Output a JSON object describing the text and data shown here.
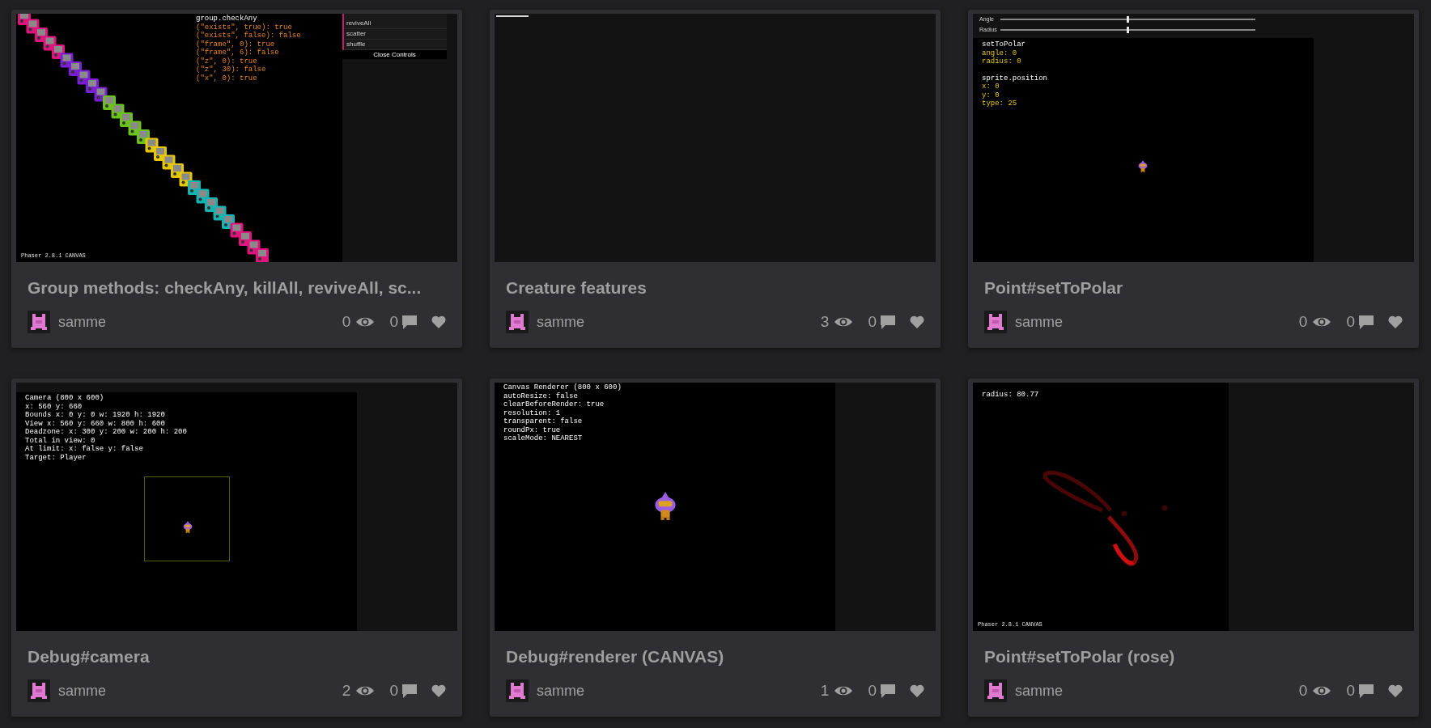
{
  "cards": [
    {
      "title": "Group methods: checkAny, killAll, reviveAll, sc...",
      "thumbnail": {
        "kind": "checkany",
        "blocks": [
          [
            {
              "text": "group.checkAny",
              "kind": "heading"
            },
            {
              "text": "(\"exists\", true): true",
              "kind": "result"
            },
            {
              "text": "(\"exists\", false): false",
              "kind": "result"
            },
            {
              "text": "(\"frame\", 0): true",
              "kind": "result"
            },
            {
              "text": "(\"frame\", 6): false",
              "kind": "result"
            },
            {
              "text": "(\"z\", 0): true",
              "kind": "result"
            },
            {
              "text": "(\"z\", 30): false",
              "kind": "result"
            },
            {
              "text": "(\"x\", 0): true",
              "kind": "result"
            }
          ]
        ],
        "menu": [
          "reviveAll",
          "scatter",
          "shuffle"
        ],
        "menu_button": "Close Controls",
        "footer": "Phaser 2.8.1 CANVAS"
      },
      "author": "samme",
      "views": "0",
      "comments": "0"
    },
    {
      "title": "Creature features",
      "thumbnail": {
        "kind": "blank"
      },
      "author": "samme",
      "views": "3",
      "comments": "0"
    },
    {
      "title": "Point#setToPolar",
      "thumbnail": {
        "kind": "polar",
        "sliders": [
          {
            "label": "Angle",
            "level": 0.5
          },
          {
            "label": "Radius",
            "level": 0.5
          }
        ],
        "blocks": [
          [
            {
              "text": "setToPolar",
              "kind": "heading"
            },
            {
              "text": "angle: 0",
              "kind": "value"
            },
            {
              "text": "radius: 0",
              "kind": "value"
            }
          ],
          [
            {
              "text": "sprite.position",
              "kind": "heading"
            },
            {
              "text": "x: 0",
              "kind": "value"
            },
            {
              "text": "y: 0",
              "kind": "value"
            },
            {
              "text": "type: 25",
              "kind": "value"
            }
          ]
        ]
      },
      "author": "samme",
      "views": "0",
      "comments": "0"
    },
    {
      "title": "Debug#camera",
      "thumbnail": {
        "kind": "camera",
        "blocks": [
          [
            {
              "text": "Camera (800 x 600)",
              "kind": "heading"
            },
            {
              "text": "x: 560 y: 660",
              "kind": "heading"
            },
            {
              "text": "Bounds x: 0 y: 0 w: 1920 h: 1920",
              "kind": "heading"
            },
            {
              "text": "View x: 560 y: 660 w: 800 h: 600",
              "kind": "heading"
            },
            {
              "text": "Deadzone: x: 300 y: 200 w: 200 h: 200",
              "kind": "heading"
            },
            {
              "text": "Total in view: 0",
              "kind": "heading"
            },
            {
              "text": "At limit: x: false y: false",
              "kind": "heading"
            },
            {
              "text": "Target: Player",
              "kind": "heading"
            }
          ]
        ]
      },
      "author": "samme",
      "views": "2",
      "comments": "0"
    },
    {
      "title": "Debug#renderer (CANVAS)",
      "thumbnail": {
        "kind": "renderer",
        "blocks": [
          [
            {
              "text": "Canvas Renderer (800 x 600)",
              "kind": "heading"
            },
            {
              "text": "autoResize: false",
              "kind": "heading"
            },
            {
              "text": "clearBeforeRender: true",
              "kind": "heading"
            },
            {
              "text": "resolution: 1",
              "kind": "heading"
            },
            {
              "text": "transparent: false",
              "kind": "heading"
            },
            {
              "text": "roundPx: true",
              "kind": "heading"
            },
            {
              "text": "scaleMode: NEAREST",
              "kind": "heading"
            }
          ]
        ]
      },
      "author": "samme",
      "views": "1",
      "comments": "0"
    },
    {
      "title": "Point#setToPolar (rose)",
      "thumbnail": {
        "kind": "rose",
        "blocks": [
          [
            {
              "text": "radius: 80.77",
              "kind": "heading"
            }
          ]
        ],
        "footer": "Phaser 2.8.1 CANVAS"
      },
      "author": "samme",
      "views": "0",
      "comments": "0"
    }
  ]
}
